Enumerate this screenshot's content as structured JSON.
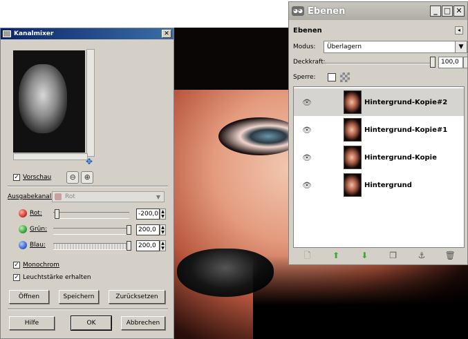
{
  "kanalmixer": {
    "title": "Kanalmixer",
    "preview_label": "Vorschau",
    "preview_checked": true,
    "output_label": "Ausgabekanal:",
    "output_value": "Rot",
    "channels": [
      {
        "label": "Rot:",
        "value": "-200,0",
        "color": "#d23a2a",
        "level_percent": 0
      },
      {
        "label": "Grün:",
        "value": "200,0",
        "color": "#3aa83a",
        "level_percent": 100
      },
      {
        "label": "Blau:",
        "value": "200,0",
        "color": "#3a6ad2",
        "level_percent": 100
      }
    ],
    "monochrom_label": "Monochrom",
    "monochrom_checked": true,
    "luminosity_label": "Leuchtstärke erhalten",
    "luminosity_checked": true,
    "buttons": {
      "open": "Öffnen",
      "save": "Speichern",
      "reset": "Zurücksetzen",
      "help": "Hilfe",
      "ok": "OK",
      "cancel": "Abbrechen"
    }
  },
  "ebenen": {
    "window_title": "Ebenen",
    "heading": "Ebenen",
    "mode_label": "Modus:",
    "mode_value": "Überlagern",
    "opacity_label": "Deckkraft:",
    "opacity_value": "100,0",
    "lock_label": "Sperre:",
    "layers": [
      {
        "name": "Hintergrund-Kopie#2",
        "selected": true
      },
      {
        "name": "Hintergrund-Kopie#1",
        "selected": false
      },
      {
        "name": "Hintergrund-Kopie",
        "selected": false
      },
      {
        "name": "Hintergrund",
        "selected": false
      }
    ]
  }
}
